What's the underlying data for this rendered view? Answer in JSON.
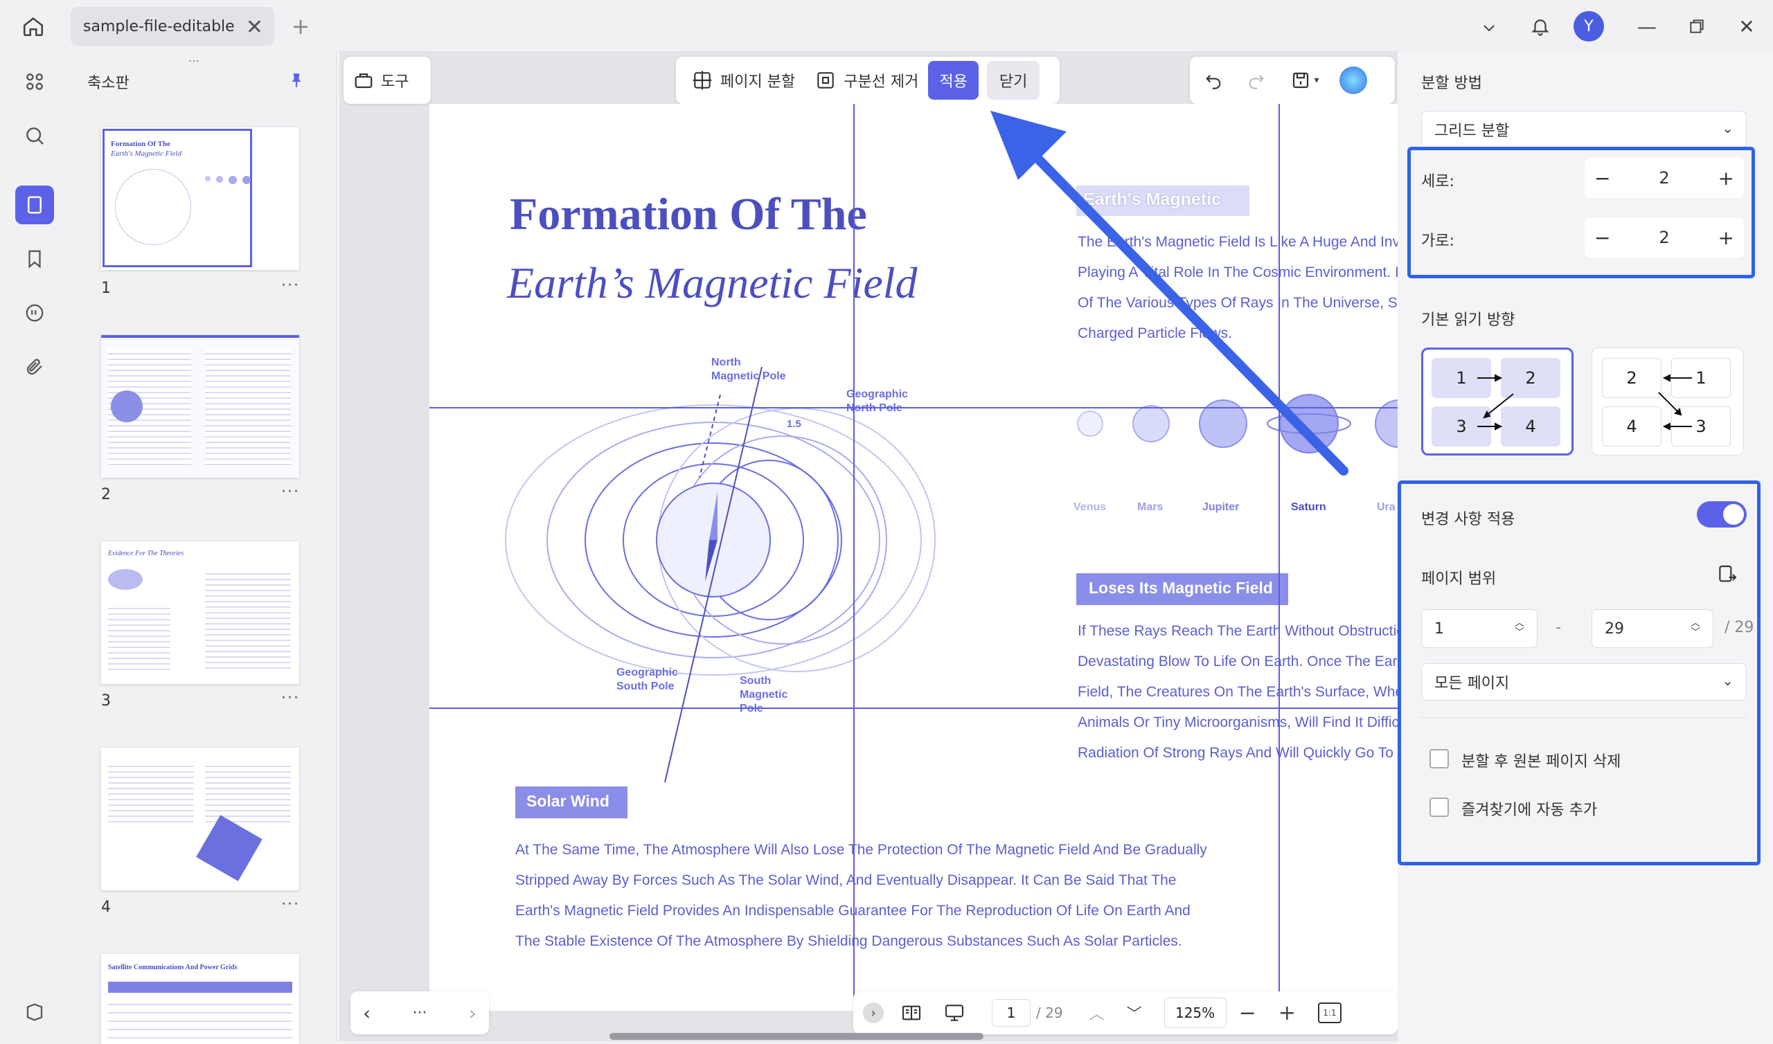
{
  "titlebar": {
    "tab_title": "sample-file-editable",
    "avatar_initial": "Y"
  },
  "thumbnails": {
    "title": "축소판",
    "pages": [
      {
        "num": "1"
      },
      {
        "num": "2"
      },
      {
        "num": "3"
      },
      {
        "num": "4"
      }
    ],
    "t1_title": "Formation Of The",
    "t1_sub": "Earth's Magnetic Field",
    "t3_title": "Evidence For The Theories",
    "t5_title": "Satellite Communications And Power Grids"
  },
  "toolbar": {
    "tools_label": "도구",
    "page_split_label": "페이지 분할",
    "remove_divider_label": "구분선 제거",
    "apply_label": "적용",
    "close_label": "닫기"
  },
  "document": {
    "title1": "Formation Of The",
    "title2": "Earth’s Magnetic Field",
    "heading_magnetic": "Earth's Magnetic",
    "para_magnetic": [
      "The Earth's Magnetic Field Is Like A Huge And Inv",
      "Playing A Vital Role In The Cosmic Environment. I",
      "Of The Various Types Of Rays In The Universe, Su",
      "Charged Particle Flows."
    ],
    "heading_loses": "Loses Its Magnetic Field",
    "para_loses": [
      "If These Rays Reach The Earth Without Obstructio",
      "Devastating Blow To Life On Earth. Once The Ear",
      "Field, The Creatures On The Earth's Surface, Whe",
      "Animals Or Tiny Microorganisms, Will Find It Diffic",
      "Radiation Of Strong Rays And Will Quickly Go To"
    ],
    "heading_solar": "Solar Wind",
    "para_solar": [
      "At The Same Time, The Atmosphere Will Also Lose The Protection Of The Magnetic Field And Be Gradually",
      "Stripped Away By Forces Such As The Solar Wind, And Eventually Disappear. It Can Be Said That The",
      "Earth's Magnetic Field Provides An Indispensable Guarantee For The Reproduction Of Life On Earth And",
      "The Stable Existence Of The Atmosphere By Shielding Dangerous Substances Such As Solar Particles."
    ],
    "diagram": {
      "north_mag": [
        "North",
        "Magnetic Pole"
      ],
      "geo_north": [
        "Geographic",
        "North Pole"
      ],
      "angle": "1.5",
      "geo_south": [
        "Geographic",
        "South Pole"
      ],
      "south_mag": [
        "South",
        "Magnetic",
        "Pole"
      ]
    },
    "planets": [
      "Venus",
      "Mars",
      "Jupiter",
      "Saturn",
      "Ura"
    ]
  },
  "split_panel": {
    "method_label": "분할 방법",
    "method_value": "그리드 분할",
    "rows_label": "세로:",
    "rows_value": "2",
    "cols_label": "가로:",
    "cols_value": "2",
    "reading_dir_label": "기본 읽기 방향",
    "option1": [
      "1",
      "2",
      "3",
      "4"
    ],
    "option2": [
      "2",
      "1",
      "4",
      "3"
    ],
    "apply_changes_label": "변경 사항 적용",
    "apply_changes_on": true,
    "page_range_label": "페이지 범위",
    "range_from": "1",
    "range_dash": "-",
    "range_to": "29",
    "range_total": "/ 29",
    "pages_select": "모든 페이지",
    "delete_original_label": "분할 후 원본 페이지 삭제",
    "auto_bookmark_label": "즐겨찾기에 자동 추가"
  },
  "bottombar": {
    "page_current": "1",
    "page_total": "/ 29",
    "zoom": "125%",
    "more": "···"
  },
  "colors": {
    "accent": "#5b62e8",
    "highlight": "#2f62e6",
    "doc_text": "#5b5fcf"
  }
}
